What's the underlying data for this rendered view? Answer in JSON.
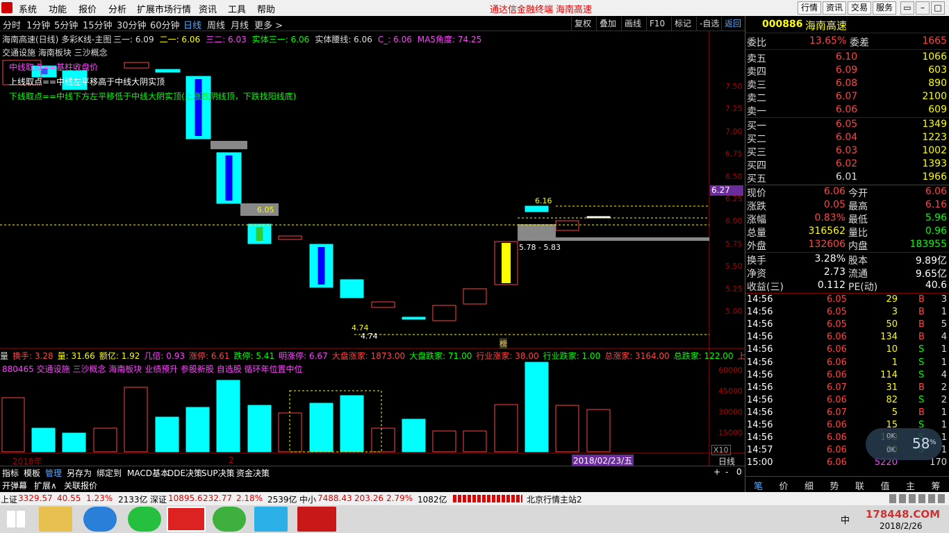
{
  "menu": [
    "系统",
    "功能",
    "报价",
    "分析",
    "扩展市场行情",
    "资讯",
    "工具",
    "帮助"
  ],
  "title_app": "通达信金融终端",
  "title_stock": "海南高速",
  "top_buttons": [
    "行情",
    "资讯",
    "交易",
    "服务"
  ],
  "win_buttons": [
    "▭",
    "–",
    "□",
    "×"
  ],
  "periods": [
    "分时",
    "1分钟",
    "5分钟",
    "15分钟",
    "30分钟",
    "60分钟",
    "日线",
    "周线",
    "月线",
    "更多 >"
  ],
  "active_period": "日线",
  "toolbar": [
    "复权",
    "叠加",
    "画线",
    "F10",
    "标记",
    "-自选",
    "返回"
  ],
  "chart_header": {
    "name": "海南高速(日线) 多彩K线-主图",
    "items": [
      {
        "label": "三一: 6.09",
        "color": "#dddddd"
      },
      {
        "label": "二一: 6.06",
        "color": "#ffff00"
      },
      {
        "label": "三二: 6.03",
        "color": "#ff44ff"
      },
      {
        "label": "实体三一: 6.06",
        "color": "#00ff00"
      },
      {
        "label": "实体腰线: 6.06",
        "color": "#dddddd"
      },
      {
        "label": "C_: 6.06",
        "color": "#ff44ff"
      },
      {
        "label": "MA5角度: 74.25",
        "color": "#ff44ff"
      }
    ]
  },
  "concepts_line": "交通设施  海南板块  三沙概念",
  "notes": [
    {
      "text": "中线取点==基柱收盘价",
      "color": "#ff44ff"
    },
    {
      "text": "上线取点==中线左平移高于中线大阴实顶",
      "color": "#ffffff"
    },
    {
      "text": "下线取点==中线下方左平移低于中线大阴实顶(上涨找阴线顶，下跌找阳线底)",
      "color": "#00ff00"
    }
  ],
  "price_labels": [
    "7.50",
    "7.25",
    "7.00",
    "6.75",
    "6.50",
    "6.25",
    "6.00",
    "5.75",
    "5.50",
    "5.25",
    "5.00"
  ],
  "current_price_tag": "6.27",
  "annotations": {
    "label_605": "6.05",
    "label_616": "6.16",
    "range_label": "5.78 - 5.83",
    "low_label1": "4.74",
    "low_label2": "4.74",
    "bang": "榜"
  },
  "indicator_bar": [
    {
      "label": "量",
      "color": "#dddddd"
    },
    {
      "label": "换手: 3.28",
      "color": "#ff4444"
    },
    {
      "label": "量: 31.66",
      "color": "#ffff00"
    },
    {
      "label": "额亿: 1.92",
      "color": "#ffff00"
    },
    {
      "label": "几倍: 0.93",
      "color": "#ff44ff"
    },
    {
      "label": "涨停: 6.61",
      "color": "#ff4444"
    },
    {
      "label": "跌停: 5.41",
      "color": "#00ff00"
    },
    {
      "label": "明涨停: 6.67",
      "color": "#ff44ff"
    },
    {
      "label": "大盘涨家: 1873.00",
      "color": "#ff4444"
    },
    {
      "label": "大盘跌家: 71.00",
      "color": "#00ff00"
    },
    {
      "label": "行业涨家: 38.00",
      "color": "#ff4444"
    },
    {
      "label": "行业跌家: 1.00",
      "color": "#00ff00"
    },
    {
      "label": "总涨家: 3164.00",
      "color": "#ff4444"
    },
    {
      "label": "总跌家: 122.00",
      "color": "#00ff00"
    },
    {
      "label": "上市日",
      "color": "#ff4444"
    }
  ],
  "sector_line": "880465 交通设施  三沙概念  海南板块  业绩预升 参股新股    自选股     循环年位置中位",
  "volume_labels": [
    "60000",
    "45000",
    "30000",
    "15000"
  ],
  "volume_unit": "X10",
  "date_axis": {
    "year": "2018年",
    "month": "2",
    "cursor_date": "2018/02/23/五",
    "period": "日线"
  },
  "stock_code": "000886",
  "stock_name": "海南高速",
  "weibi": {
    "label": "委比",
    "pct": "13.65%",
    "label2": "委差",
    "value": "1665"
  },
  "asks": [
    {
      "label": "卖五",
      "price": "6.10",
      "vol": "1066"
    },
    {
      "label": "卖四",
      "price": "6.09",
      "vol": "603"
    },
    {
      "label": "卖三",
      "price": "6.08",
      "vol": "890"
    },
    {
      "label": "卖二",
      "price": "6.07",
      "vol": "2100"
    },
    {
      "label": "卖一",
      "price": "6.06",
      "vol": "609"
    }
  ],
  "bids": [
    {
      "label": "买一",
      "price": "6.05",
      "vol": "1349"
    },
    {
      "label": "买二",
      "price": "6.04",
      "vol": "1223"
    },
    {
      "label": "买三",
      "price": "6.03",
      "vol": "1002"
    },
    {
      "label": "买四",
      "price": "6.02",
      "vol": "1393"
    },
    {
      "label": "买五",
      "price": "6.01",
      "vol": "1966"
    }
  ],
  "quote": [
    {
      "l1": "现价",
      "v1": "6.06",
      "l2": "今开",
      "v2": "6.06",
      "c1": "#ff4444",
      "c2": "#ff4444"
    },
    {
      "l1": "涨跌",
      "v1": "0.05",
      "l2": "最高",
      "v2": "6.16",
      "c1": "#ff4444",
      "c2": "#ff4444"
    },
    {
      "l1": "涨幅",
      "v1": "0.83%",
      "l2": "最低",
      "v2": "5.96",
      "c1": "#ff4444",
      "c2": "#00ff00"
    },
    {
      "l1": "总量",
      "v1": "316562",
      "l2": "量比",
      "v2": "0.96",
      "c1": "#ffff00",
      "c2": "#00ff00"
    },
    {
      "l1": "外盘",
      "v1": "132606",
      "l2": "内盘",
      "v2": "183955",
      "c1": "#ff4444",
      "c2": "#00ff00"
    }
  ],
  "fundamentals": [
    {
      "l1": "换手",
      "v1": "3.28%",
      "l2": "股本",
      "v2": "9.89亿"
    },
    {
      "l1": "净资",
      "v1": "2.73",
      "l2": "流通",
      "v2": "9.65亿"
    },
    {
      "l1": "收益(三)",
      "v1": "0.112",
      "l2": "PE(动)",
      "v2": "40.6"
    }
  ],
  "ticks": [
    {
      "time": "14:56",
      "price": "6.05",
      "vol": "29",
      "side": "B",
      "n": "3"
    },
    {
      "time": "14:56",
      "price": "6.05",
      "vol": "3",
      "side": "B",
      "n": "1"
    },
    {
      "time": "14:56",
      "price": "6.05",
      "vol": "50",
      "side": "B",
      "n": "5"
    },
    {
      "time": "14:56",
      "price": "6.06",
      "vol": "134",
      "side": "B",
      "n": "4"
    },
    {
      "time": "14:56",
      "price": "6.06",
      "vol": "10",
      "side": "S",
      "n": "1"
    },
    {
      "time": "14:56",
      "price": "6.06",
      "vol": "1",
      "side": "S",
      "n": "1"
    },
    {
      "time": "14:56",
      "price": "6.06",
      "vol": "114",
      "side": "S",
      "n": "4"
    },
    {
      "time": "14:56",
      "price": "6.07",
      "vol": "31",
      "side": "B",
      "n": "2"
    },
    {
      "time": "14:56",
      "price": "6.06",
      "vol": "82",
      "side": "S",
      "n": "2"
    },
    {
      "time": "14:56",
      "price": "6.07",
      "vol": "5",
      "side": "B",
      "n": "1"
    },
    {
      "time": "14:56",
      "price": "6.06",
      "vol": "15",
      "side": "S",
      "n": "1"
    },
    {
      "time": "14:56",
      "price": "6.06",
      "vol": "100",
      "side": "S",
      "n": "1"
    },
    {
      "time": "14:57",
      "price": "6.06",
      "vol": "30",
      "side": "S",
      "n": "1"
    },
    {
      "time": "15:00",
      "price": "6.06",
      "vol": "5220",
      "side": "",
      "n": "170"
    }
  ],
  "rp_tabs": [
    "笔",
    "价",
    "细",
    "势",
    "联",
    "值",
    "主",
    "筹"
  ],
  "bottom_tabs": [
    "指标",
    "模板",
    "管理",
    "另存为",
    "绑定到",
    "MACD基本",
    "DDE决策",
    "SUP决策",
    "资金决策"
  ],
  "bottom_tabs2": [
    "开弹幕",
    "扩展∧",
    "关联报价"
  ],
  "speed": {
    "value": "58",
    "unit": "%",
    "up": "0K",
    "down": "0K"
  },
  "status": [
    {
      "name": "上证",
      "val": "3329.57",
      "chg": "40.55",
      "pct": "1.23%",
      "amt": "2133亿"
    },
    {
      "name": "深证",
      "val": "10895.6",
      "chg": "232.77",
      "pct": "2.18%",
      "amt": "2539亿"
    },
    {
      "name": "中小",
      "val": "7488.43",
      "chg": "203.26",
      "pct": "2.79%",
      "amt": "1082亿"
    }
  ],
  "server": "北京行情主站2",
  "tray": {
    "ime": "中",
    "watermark": "178448.COM",
    "date": "2018/2/26"
  }
}
